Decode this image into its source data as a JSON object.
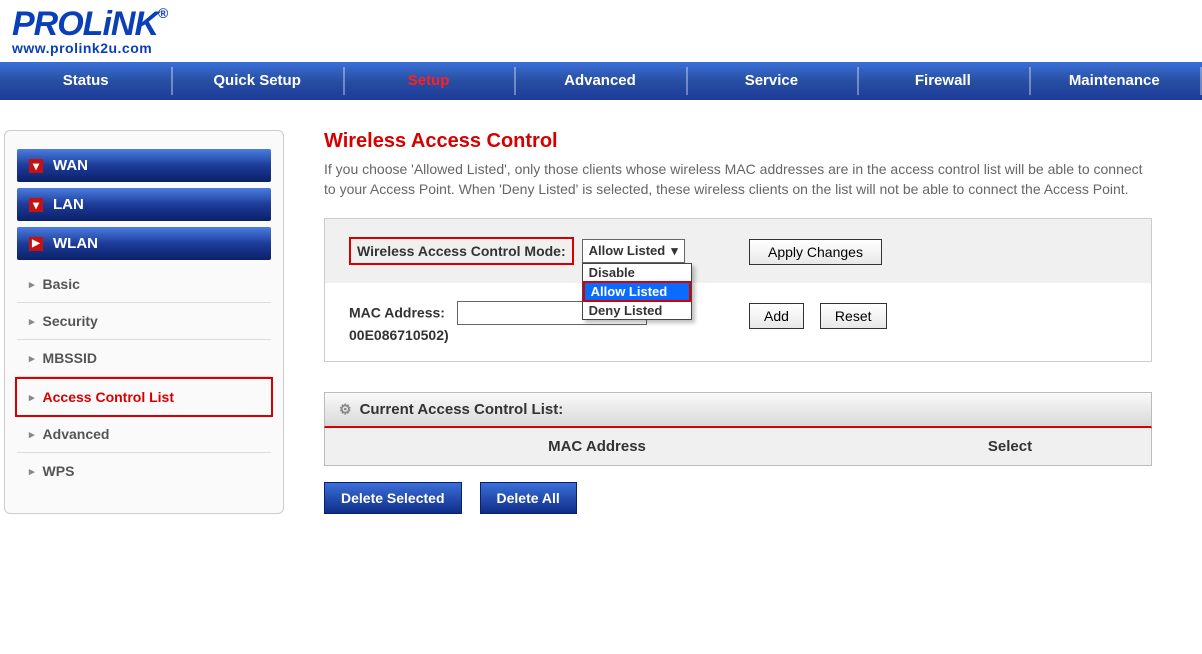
{
  "brand": {
    "name": "PROLiNK",
    "reg": "®",
    "url": "www.prolink2u.com"
  },
  "nav": {
    "status": "Status",
    "quick_setup": "Quick Setup",
    "setup": "Setup",
    "advanced": "Advanced",
    "service": "Service",
    "firewall": "Firewall",
    "maintenance": "Maintenance"
  },
  "sidebar": {
    "wan": "WAN",
    "lan": "LAN",
    "wlan": "WLAN",
    "subs": {
      "basic": "Basic",
      "security": "Security",
      "mbssid": "MBSSID",
      "acl": "Access Control List",
      "advanced": "Advanced",
      "wps": "WPS"
    }
  },
  "page": {
    "title": "Wireless Access Control",
    "intro": "If you choose 'Allowed Listed', only those clients whose wireless MAC addresses are in the access control list will be able to connect to your Access Point. When 'Deny Listed' is selected, these wireless clients on the list will not be able to connect the Access Point."
  },
  "form": {
    "mode_label": "Wireless Access Control Mode:",
    "mode_value": "Allow Listed",
    "mode_options": {
      "disable": "Disable",
      "allow": "Allow Listed",
      "deny": "Deny Listed"
    },
    "apply_label": "Apply Changes",
    "mac_label": "MAC Address:",
    "mac_value": "",
    "mac_example": "00E086710502)",
    "add_label": "Add",
    "reset_label": "Reset"
  },
  "list": {
    "section_title": "Current Access Control List:",
    "col_mac": "MAC Address",
    "col_select": "Select"
  },
  "buttons": {
    "delete_selected": "Delete Selected",
    "delete_all": "Delete All"
  }
}
